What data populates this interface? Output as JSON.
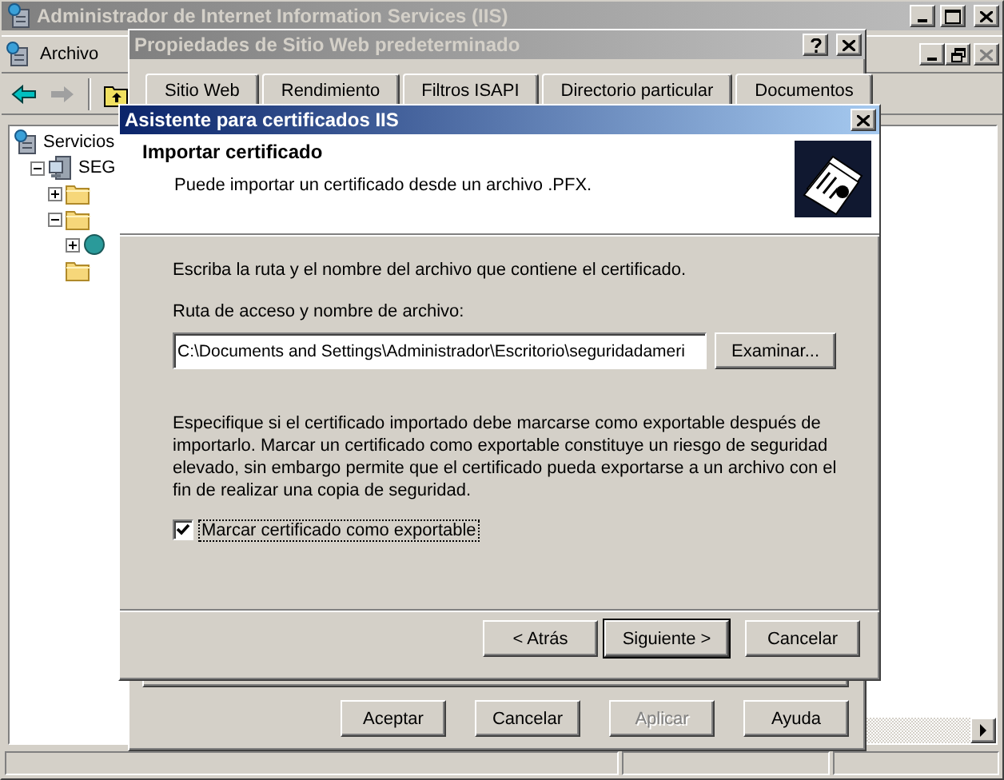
{
  "main_window": {
    "title": "Administrador de Internet Information Services (IIS)",
    "menu": [
      {
        "label": "Archivo"
      }
    ],
    "tree": [
      {
        "label": "Servicios",
        "kind": "services",
        "children": [
          {
            "label": "SEG",
            "kind": "computer",
            "expanded": true,
            "children": [
              {
                "kind": "folder",
                "expanded": false
              },
              {
                "kind": "folder",
                "expanded": true,
                "children": [
                  {
                    "kind": "site",
                    "expanded": false
                  }
                ]
              },
              {
                "kind": "folder"
              }
            ]
          }
        ]
      }
    ]
  },
  "properties_dialog": {
    "title": "Propiedades de Sitio Web predeterminado",
    "tabs": [
      {
        "label": "Sitio Web",
        "selected": false
      },
      {
        "label": "Rendimiento",
        "selected": false
      },
      {
        "label": "Filtros ISAPI",
        "selected": false
      },
      {
        "label": "Directorio particular",
        "selected": false
      },
      {
        "label": "Documentos",
        "selected": false
      }
    ],
    "buttons": [
      {
        "label": "Aceptar",
        "disabled": false
      },
      {
        "label": "Cancelar",
        "disabled": false
      },
      {
        "label": "Aplicar",
        "disabled": true
      },
      {
        "label": "Ayuda",
        "disabled": false
      }
    ]
  },
  "wizard": {
    "title": "Asistente para certificados IIS",
    "heading": "Importar certificado",
    "subheading": "Puede importar un certificado desde un archivo .PFX.",
    "instruction": "Escriba la ruta y el nombre del archivo que contiene el certificado.",
    "path_label": "Ruta de acceso y nombre de archivo:",
    "path_value": "C:\\Documents and Settings\\Administrador\\Escritorio\\seguridadameri",
    "browse_button": "Examinar...",
    "export_note": "Especifique si el certificado importado debe marcarse como exportable después de importarlo.  Marcar un certificado como exportable constituye un riesgo de seguridad elevado, sin embargo permite que el certificado pueda exportarse a un archivo con el fin de realizar una copia de seguridad.",
    "export_checkbox": {
      "label": "Marcar certificado como exportable",
      "checked": true
    },
    "buttons": [
      {
        "label": "< Atrás",
        "default": false
      },
      {
        "label": "Siguiente >",
        "default": true
      },
      {
        "label": "Cancelar",
        "default": false
      }
    ]
  }
}
